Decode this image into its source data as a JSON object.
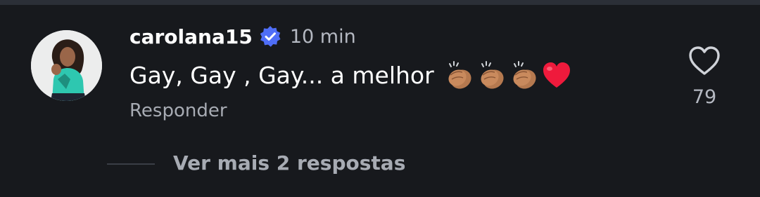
{
  "comment": {
    "username": "carolana15",
    "time": "10 min",
    "text": "Gay, Gay , Gay... a melhor",
    "emojis": [
      "clapping-hands-medium-skin",
      "clapping-hands-medium-skin",
      "clapping-hands-medium-skin",
      "red-heart"
    ],
    "reply_label": "Responder",
    "like_count": "79",
    "more_replies_label": "Ver mais 2 respostas"
  },
  "colors": {
    "background": "#17191d",
    "verified_badge": "#4f6ef7",
    "muted_text": "#a7abb3",
    "heart_red": "#ef1a3c"
  },
  "icons": {
    "verified": "verified-badge-icon",
    "like": "heart-outline-icon"
  }
}
